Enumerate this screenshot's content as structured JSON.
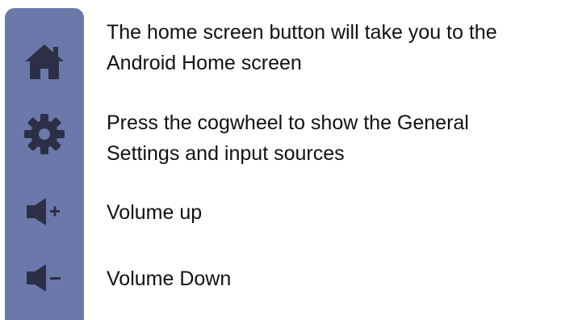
{
  "icon_colors": {
    "panel": "#6b79aa",
    "icon": "#2c2f45"
  },
  "buttons": [
    {
      "icon": "home-icon",
      "line1": "The home screen button will take you to the",
      "line2": "Android Home screen"
    },
    {
      "icon": "gear-icon",
      "line1": "Press the cogwheel to show the General",
      "line2": "Settings and input sources"
    },
    {
      "icon": "volume-up-icon",
      "line1": "Volume up"
    },
    {
      "icon": "volume-down-icon",
      "line1": "Volume Down"
    }
  ]
}
